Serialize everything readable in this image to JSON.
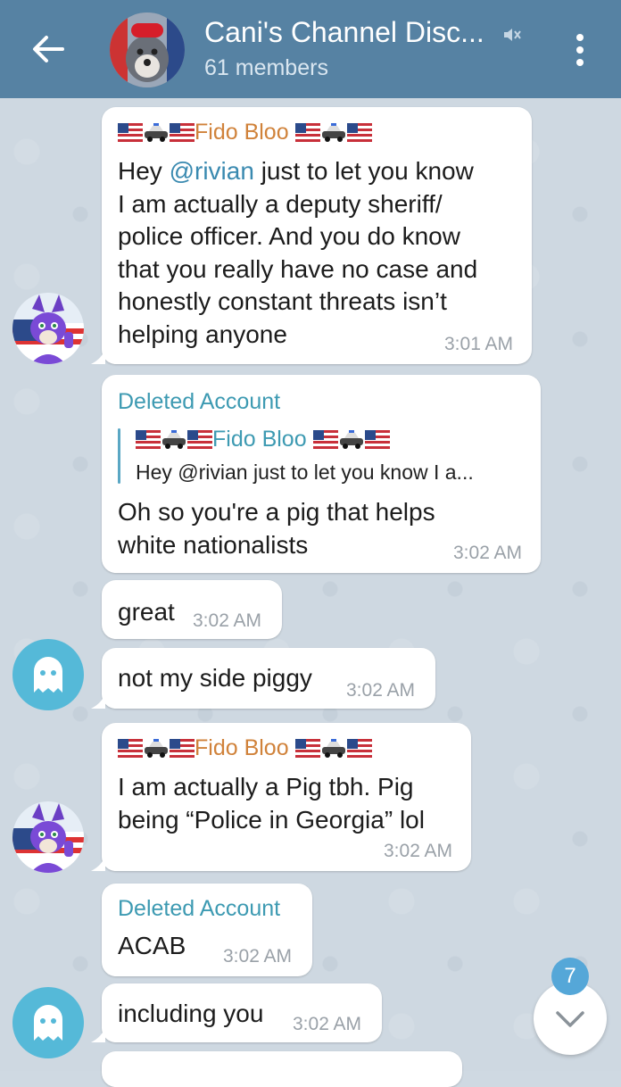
{
  "header": {
    "title": "Cani's Channel Disc...",
    "subtitle": "61 members",
    "icons": {
      "back": "arrow-left-icon",
      "mute": "muted-speaker-icon",
      "menu": "more-vertical-icon"
    },
    "color": "#5682a3"
  },
  "messages": [
    {
      "sender": "Fido Bloo",
      "text_before_mention": "Hey ",
      "mention": "@rivian",
      "text_after_mention": " just to let you know\nI am actually a deputy sheriff/\npolice officer.  And you do know\nthat you really have no case and\nhonestly constant threats isn’t\nhelping anyone",
      "time": "3:01 AM"
    },
    {
      "sender": "Deleted Account",
      "reply_to_name": "Fido Bloo",
      "reply_to_text": "Hey @rivian just to let you know I a...",
      "text": "Oh so you're a pig that helps\nwhite nationalists",
      "time": "3:02 AM"
    },
    {
      "text": "great",
      "time": "3:02 AM"
    },
    {
      "text": "not my side piggy",
      "time": "3:02 AM"
    },
    {
      "sender": "Fido Bloo",
      "text": "I am actually a Pig tbh.  Pig\nbeing “Police in Georgia” lol",
      "time": "3:02 AM"
    },
    {
      "sender": "Deleted Account",
      "text": "ACAB",
      "time": "3:02 AM"
    },
    {
      "text": "including you",
      "time": "3:02 AM"
    }
  ],
  "scroll_button": {
    "icon": "chevron-down-icon",
    "unread_count": "7"
  },
  "colors": {
    "accent": "#55a7d8",
    "sender_orange": "#d0823a",
    "sender_blue": "#3d9ab2"
  }
}
